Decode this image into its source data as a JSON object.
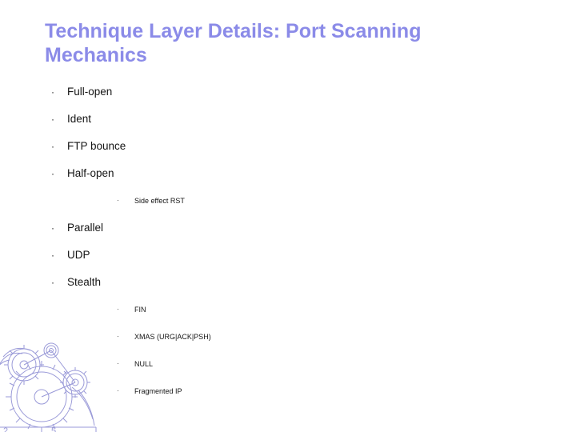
{
  "slide": {
    "title": "Technique Layer Details: Port Scanning Mechanics",
    "bullets": [
      {
        "level": 1,
        "text": "Full-open"
      },
      {
        "level": 1,
        "text": "Ident"
      },
      {
        "level": 1,
        "text": "FTP bounce"
      },
      {
        "level": 1,
        "text": "Half-open"
      },
      {
        "level": 2,
        "text": "Side effect RST"
      },
      {
        "level": 1,
        "text": "Parallel"
      },
      {
        "level": 1,
        "text": "UDP"
      },
      {
        "level": 1,
        "text": "Stealth"
      },
      {
        "level": 2,
        "text": "FIN"
      },
      {
        "level": 2,
        "text": "XMAS (URG|ACK|PSH)"
      },
      {
        "level": 2,
        "text": "NULL"
      },
      {
        "level": 2,
        "text": "Fragmented IP"
      }
    ],
    "bullet_glyph_l1": "·",
    "bullet_glyph_l2": "·",
    "colors": {
      "title": "#8b8be8",
      "text": "#151515",
      "background": "#ffffff",
      "artwork_line": "#9a9ad8"
    }
  }
}
